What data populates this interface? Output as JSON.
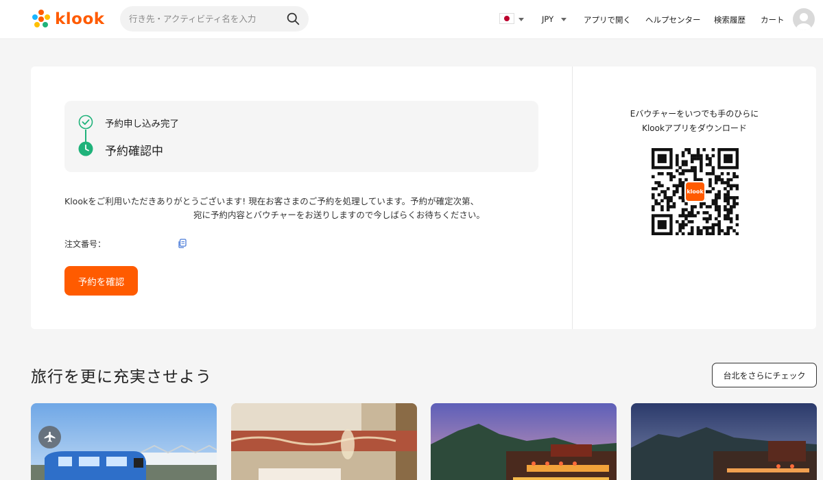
{
  "brand": {
    "name": "klook",
    "accent": "#ff5b00",
    "success": "#1fb27a"
  },
  "header": {
    "search_placeholder": "行き先・アクティビティ名を入力",
    "language_flag": "japan-flag-icon",
    "currency": "JPY",
    "links": [
      "アプリで開く",
      "ヘルプセンター",
      "検索履歴",
      "カート"
    ]
  },
  "booking": {
    "steps": [
      {
        "label": "予約申し込み完了",
        "state": "done"
      },
      {
        "label": "予約確認中",
        "state": "current"
      }
    ],
    "message_line1": "Klookをご利用いただきありがとうございます! 現在お客さまのご予約を処理しています。予約が確定次第、",
    "message_line2": "宛に予約内容とバウチャーをお送りしますので今しばらくお待ちください。",
    "order_number_label": "注文番号：",
    "confirm_button": "予約を確認"
  },
  "app_promo": {
    "line1": "Eバウチャーをいつでも手のひらに",
    "line2": "Klookアプリをダウンロード",
    "qr_logo_text": "klook"
  },
  "recommendations": {
    "title": "旅行を更に充実させよう",
    "city_button": "台北をさらにチェック",
    "tiles": [
      {
        "name": "airport-train",
        "badge_icon": "airplane-icon"
      },
      {
        "name": "spa-room"
      },
      {
        "name": "jiufen-night-view"
      },
      {
        "name": "jiufen-dusk"
      }
    ]
  }
}
